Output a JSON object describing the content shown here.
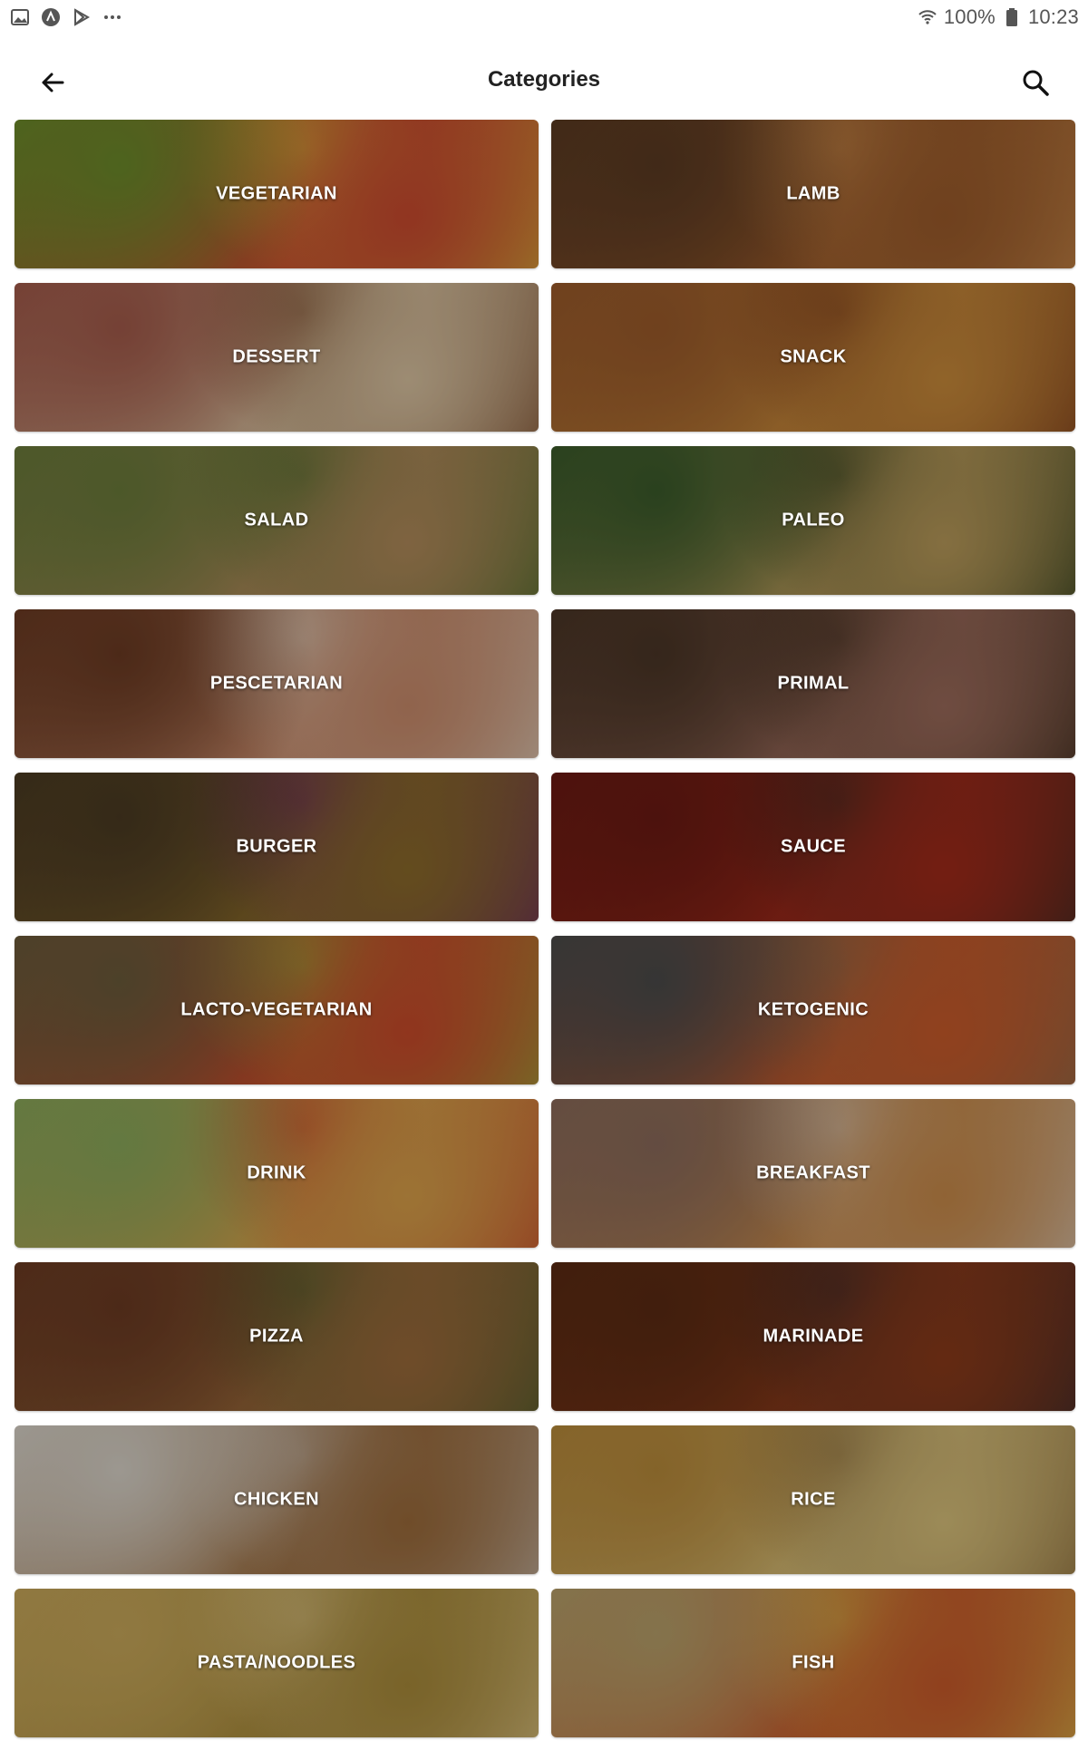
{
  "status_bar": {
    "left_icons": [
      "image-icon",
      "circle-a-icon",
      "play-store-icon",
      "more-dots-icon"
    ],
    "battery_percent": "100%",
    "time": "10:23"
  },
  "app_bar": {
    "title": "Categories",
    "back_icon": "arrow-left-icon",
    "search_icon": "search-icon"
  },
  "categories": [
    {
      "label": "VEGETARIAN",
      "bg": [
        "#6b8a2a",
        "#c94a2f",
        "#d8b23a"
      ]
    },
    {
      "label": "LAMB",
      "bg": [
        "#5a3a22",
        "#9a5a2a",
        "#c98a4a"
      ]
    },
    {
      "label": "DESSERT",
      "bg": [
        "#a25a4a",
        "#d9c2a0",
        "#7a4a2a"
      ]
    },
    {
      "label": "SNACK",
      "bg": [
        "#9a5a2a",
        "#c88a3a",
        "#7a3a1a"
      ]
    },
    {
      "label": "SALAD",
      "bg": [
        "#6a7a3a",
        "#b08a5a",
        "#4a6a2a"
      ]
    },
    {
      "label": "PALEO",
      "bg": [
        "#3a5a2a",
        "#b89a5a",
        "#2a3a1a"
      ]
    },
    {
      "label": "PESCETARIAN",
      "bg": [
        "#6a3a22",
        "#c88a6a",
        "#e0d2c0"
      ]
    },
    {
      "label": "PRIMAL",
      "bg": [
        "#4a3526",
        "#9a6a5a",
        "#3a2a1a"
      ]
    },
    {
      "label": "BURGER",
      "bg": [
        "#4a3a22",
        "#8a6a2a",
        "#6a2a5a"
      ]
    },
    {
      "label": "SAUCE",
      "bg": [
        "#6a1a12",
        "#a02a1a",
        "#3a2a22"
      ]
    },
    {
      "label": "LACTO-VEGETARIAN",
      "bg": [
        "#6a5a3a",
        "#c84a2a",
        "#9aa83a"
      ]
    },
    {
      "label": "KETOGENIC",
      "bg": [
        "#4a4a4a",
        "#c85a2a",
        "#8a6a4a"
      ]
    },
    {
      "label": "DRINK",
      "bg": [
        "#8aa85a",
        "#d8a04a",
        "#c84a2a"
      ]
    },
    {
      "label": "BREAKFAST",
      "bg": [
        "#8a6a5a",
        "#c88a4a",
        "#d8c8b8"
      ]
    },
    {
      "label": "PIZZA",
      "bg": [
        "#6a3a22",
        "#9a6a3a",
        "#4a5a2a"
      ]
    },
    {
      "label": "MARINADE",
      "bg": [
        "#5a2a12",
        "#8a3a1a",
        "#3a2a2a"
      ]
    },
    {
      "label": "CHICKEN",
      "bg": [
        "#d8d2c8",
        "#9a6a3a",
        "#c8bcb0"
      ]
    },
    {
      "label": "RICE",
      "bg": [
        "#b88a3a",
        "#d8c07a",
        "#8a6a3a"
      ]
    },
    {
      "label": "PASTA/NOODLES",
      "bg": [
        "#c8a85a",
        "#a88a3a",
        "#e0c88a"
      ]
    },
    {
      "label": "FISH",
      "bg": [
        "#b8a06a",
        "#c85a2a",
        "#d8b84a"
      ]
    }
  ]
}
